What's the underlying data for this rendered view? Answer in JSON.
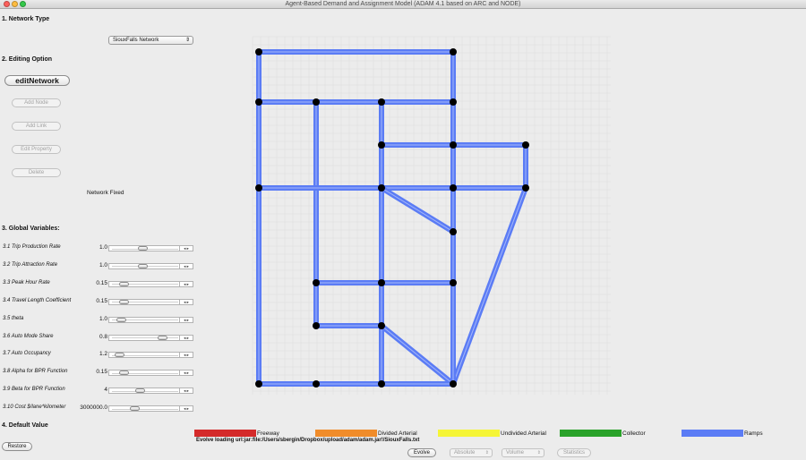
{
  "window": {
    "title": "Agent-Based Demand and Assignment Model (ADAM 4.1 based on ARC and NODE)"
  },
  "sections": {
    "network_type": "1. Network Type",
    "editing_option": "2. Editing Option",
    "global_variables": "3. Global Variables:",
    "default_value": "4. Default Value"
  },
  "network_select": {
    "value": "SiouxFalls Network",
    "arrow": "⇕"
  },
  "edit": {
    "main_label": "editNetwork",
    "add_node": "Add Node",
    "add_link": "Add Link",
    "edit_property": "Edit Property",
    "delete": "Delete"
  },
  "status_text": "Network Fixed",
  "slider_steps": "◂ ▸",
  "variables": [
    {
      "label": "3.1 Trip Production Rate",
      "value": "1.0",
      "level": 0.45
    },
    {
      "label": "3.2 Trip Attraction Rate",
      "value": "1.0",
      "level": 0.45
    },
    {
      "label": "3.3 Peak Hour Rate",
      "value": "0.15",
      "level": 0.12
    },
    {
      "label": "3.4 Travel Length Coefficient",
      "value": "0.15",
      "level": 0.12
    },
    {
      "label": "3.5 theta",
      "value": "1.0",
      "level": 0.08
    },
    {
      "label": "3.6 Auto Mode Share",
      "value": "0.8",
      "level": 0.78
    },
    {
      "label": "3.7 Auto Occupancy",
      "value": "1.2",
      "level": 0.04
    },
    {
      "label": "3.8 Alpha for BPR Function",
      "value": "0.15",
      "level": 0.12
    },
    {
      "label": "3.9 Beta for BPR Function",
      "value": "4",
      "level": 0.4
    },
    {
      "label": "3.10 Cost $/lane*kilometer",
      "value": "3000000.0",
      "level": 0.3
    }
  ],
  "restore_label": "Restore",
  "legend": [
    {
      "label": "Freeway",
      "color": "#d42a2a"
    },
    {
      "label": "Divided Arterial",
      "color": "#f08c2a"
    },
    {
      "label": "Undivided Arterial",
      "color": "#f5f536"
    },
    {
      "label": "Collector",
      "color": "#2aa22a"
    },
    {
      "label": "Ramps",
      "color": "#5b7cf5"
    }
  ],
  "loading_text": "Evolve loading url:jar:file:/Users/sbergin/Dropbox/upload/adam/adam.jar!/SiouxFalls.txt",
  "bottom": {
    "evolve": "Evolve",
    "absolute": "Absolute",
    "volume": "Volume",
    "statistics": "Statistics",
    "select_arrow": "⇕"
  },
  "link_color": "#5b7cf5",
  "node_color": "#000000",
  "grid_color": "#dcdcdc"
}
